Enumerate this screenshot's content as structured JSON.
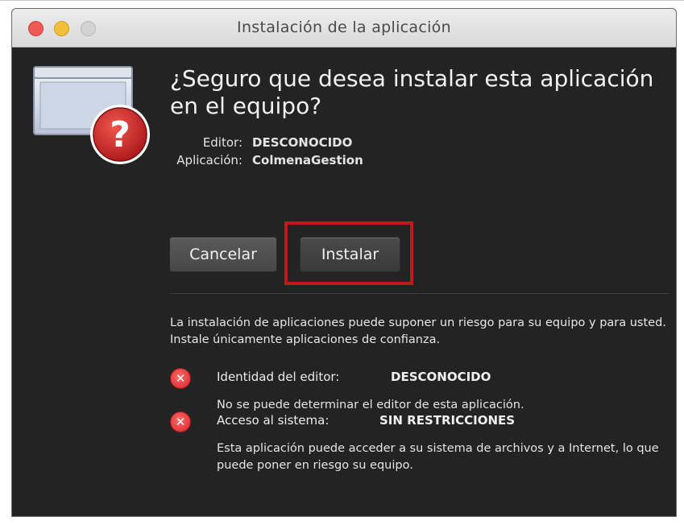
{
  "window": {
    "title": "Instalación de la aplicación"
  },
  "dialog": {
    "question": "¿Seguro que desea instalar esta aplicación en el equipo?",
    "publisher_label": "Editor:",
    "publisher_value": "DESCONOCIDO",
    "application_label": "Aplicación:",
    "application_value": "ColmenaGestion",
    "cancel_label": "Cancelar",
    "install_label": "Instalar",
    "warning_text": "La instalación de aplicaciones puede suponer un riesgo para su equipo y para usted. Instale únicamente aplicaciones de confianza.",
    "risks": [
      {
        "label": "Identidad del editor:",
        "value": "DESCONOCIDO",
        "description": "No se puede determinar el editor de esta aplicación."
      },
      {
        "label": "Acceso al sistema:",
        "value": "SIN RESTRICCIONES",
        "description": "Esta aplicación puede acceder a su sistema de archivos y a Internet, lo que puede poner en riesgo su equipo."
      }
    ]
  },
  "colors": {
    "highlight": "#c4161c",
    "dialog_background": "#232323",
    "error_icon": "#d1262a"
  },
  "icons": {
    "app_icon": "window-question-icon",
    "risk_icon": "error-x-icon"
  }
}
